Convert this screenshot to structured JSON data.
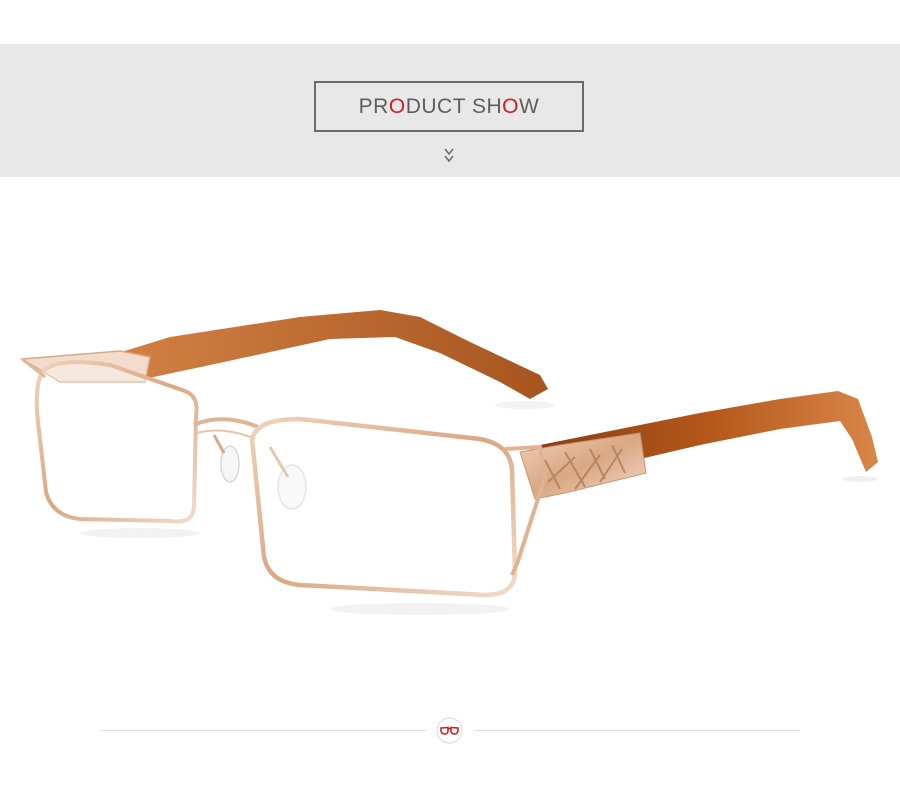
{
  "header": {
    "title_parts": [
      "PR",
      "O",
      "DUCT SH",
      "O",
      "W"
    ],
    "accent_color": "#d21f1f",
    "scroll_icon": "double-chevron-down-icon"
  },
  "product": {
    "frame_color": "#e2b592",
    "temple_color": "#a7521a"
  },
  "footer": {
    "logo_icon": "glasses-logo-icon"
  }
}
